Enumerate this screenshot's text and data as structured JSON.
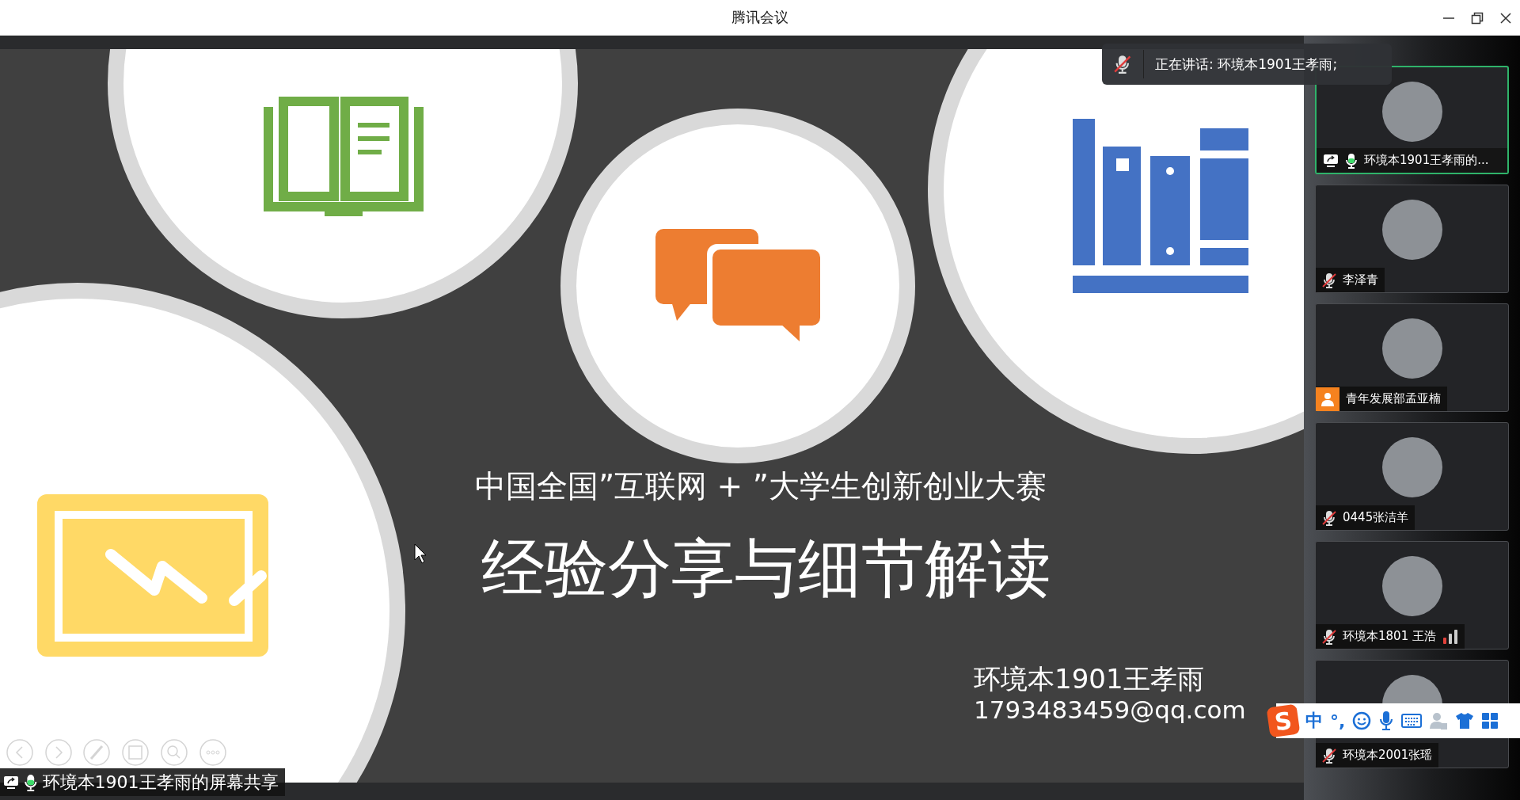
{
  "window": {
    "title": "腾讯会议"
  },
  "slide": {
    "subtitle": "中国全国”互联网 + ”大学生创新创业大赛",
    "title": "经验分享与细节解读",
    "author": "环境本1901王孝雨",
    "email": "1793483459@qq.com"
  },
  "speaker_banner": {
    "text": "正在讲话: 环境本1901王孝雨;",
    "muted": true
  },
  "share_label": {
    "text": "环境本1901王孝雨的屏幕共享",
    "sharing": true,
    "mic_active": true
  },
  "participants": [
    {
      "kind": "presenter",
      "name": "环境本1901王孝雨的...",
      "selected": true,
      "weak_signal": false
    },
    {
      "kind": "muted",
      "name": "李泽青",
      "selected": false,
      "weak_signal": false
    },
    {
      "kind": "guest",
      "name": "青年发展部孟亚楠",
      "selected": false,
      "weak_signal": false
    },
    {
      "kind": "muted",
      "name": "0445张洁羊",
      "selected": false,
      "weak_signal": false
    },
    {
      "kind": "muted",
      "name": "环境本1801 王浩",
      "selected": false,
      "weak_signal": true
    },
    {
      "kind": "muted",
      "name": "环境本2001张瑶",
      "selected": false,
      "weak_signal": false
    }
  ],
  "input_method_bar": {
    "logo": "S",
    "mode": "中",
    "punctuation": "°,"
  }
}
